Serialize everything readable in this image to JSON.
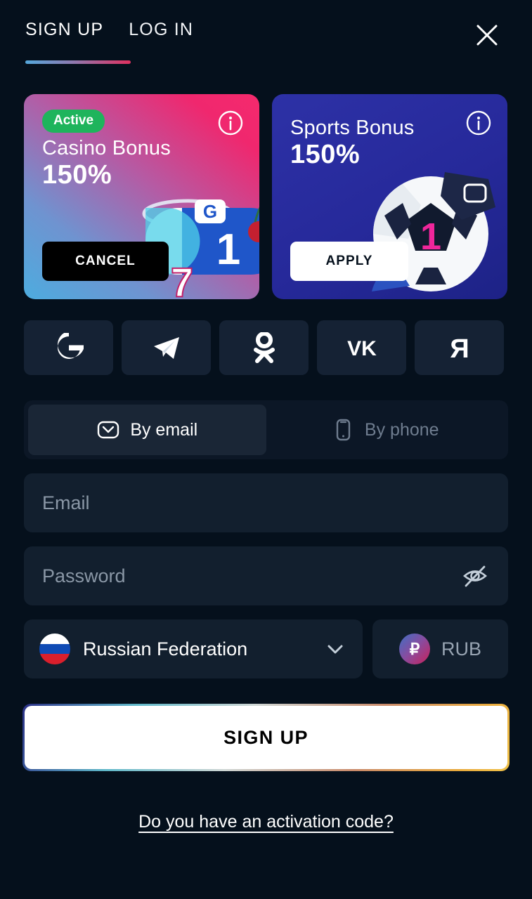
{
  "header": {
    "tabs": [
      {
        "label": "SIGN UP",
        "active": true
      },
      {
        "label": "LOG IN",
        "active": false
      }
    ],
    "close_icon": "close-icon",
    "underline_gradient_from": "#55a8dc",
    "underline_gradient_to": "#e0305f"
  },
  "bonuses": [
    {
      "badge": "Active",
      "title": "Casino Bonus",
      "percent": "150%",
      "button": "CANCEL",
      "info_icon": "info-icon",
      "gradient_from": "#4dacdf",
      "gradient_to": "#f0276e"
    },
    {
      "badge": "",
      "title": "Sports Bonus",
      "percent": "150%",
      "button": "APPLY",
      "info_icon": "info-icon",
      "gradient_from": "#2d31a6",
      "gradient_to": "#1d2286"
    }
  ],
  "social": [
    {
      "name": "google-icon",
      "label": "G"
    },
    {
      "name": "telegram-icon",
      "label": "Telegram"
    },
    {
      "name": "odnoklassniki-icon",
      "label": "OK"
    },
    {
      "name": "vk-icon",
      "label": "VK"
    },
    {
      "name": "yandex-icon",
      "label": "Я"
    }
  ],
  "method_toggle": {
    "email_label": "By email",
    "phone_label": "By phone",
    "selected": "email"
  },
  "form": {
    "email_placeholder": "Email",
    "email_value": "",
    "password_placeholder": "Password",
    "password_value": "",
    "password_visible": false,
    "country": "Russian Federation",
    "currency": "RUB",
    "currency_symbol": "₽"
  },
  "submit": {
    "label": "SIGN UP"
  },
  "activation": {
    "label": "Do you have an activation code?"
  },
  "colors": {
    "page_bg": "#05101c",
    "field_bg": "#121f2e",
    "social_bg": "#152234",
    "badge_green": "#1eb45c",
    "accent_pink": "#f0276e",
    "accent_blue": "#4dacdf"
  }
}
